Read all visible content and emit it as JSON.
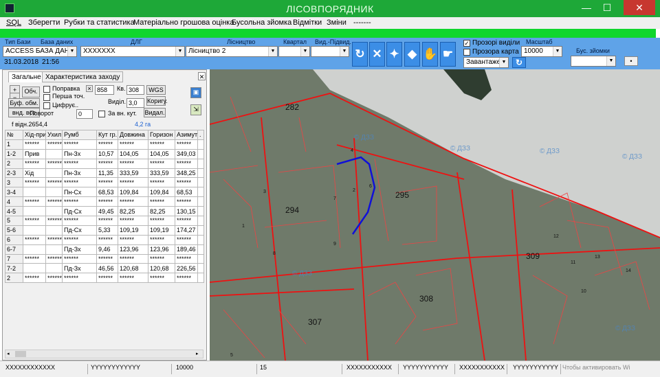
{
  "window": {
    "title": "ЛІСОВПОРЯДНИК",
    "minimize": "—",
    "maximize": "☐",
    "close": "✕"
  },
  "menu": [
    "SQL",
    "Зберегти",
    "Рубки та статистика",
    "Матеріально грошова оцінка",
    "Бусольна зйомка",
    "Відмітки",
    "Зміни",
    "-------"
  ],
  "toolbar": {
    "db_type_label": "Тип Бази",
    "db_label": "База даних",
    "db_value": "ACCESS БАЗА ДАНИ",
    "date": "31.03.2018",
    "time": "21:56",
    "dlg_label": "ДЛГ",
    "dlg_value": "XXXXXXX",
    "forestry_label": "Лісництво",
    "forestry_value": "Лісництво 2",
    "quarter_label": "Квартал",
    "quarter_value": "",
    "subplot_label": "Вид.-Підвид.",
    "subplot_value": "",
    "transparent_plots_label": "Прозорі виділи",
    "transparent_plots_checked": true,
    "transparent_map_label": "Прозора карта",
    "transparent_map_checked": false,
    "load_value": "Завантаже",
    "scale_label": "Масштаб",
    "scale_value": "10000",
    "survey_label": "Бус. зйомки",
    "survey_value": "",
    "small_button": "•"
  },
  "left": {
    "tabs": [
      "Загальне",
      "Характеристика заходу"
    ],
    "close": "✕",
    "plus": "+",
    "minus": "−",
    "calc_button": "Обч.",
    "buffer_button": "Буф. обм.",
    "all_button": "внд. все",
    "correction_label": "Поправка",
    "first_point_label": "Перша точ.",
    "digitize_label": "Цифрує..",
    "rotation_label": "Поворот",
    "rotation_value": "0",
    "small_x": "×",
    "num_value": "858",
    "kv_label": "Кв.",
    "kv_value": "308",
    "wgs_button": "WGS",
    "vydil_label": "Виділ.",
    "vydil_value": "3,0",
    "korig_button": "Коригу.",
    "za_vn_label": "За вн. кут.",
    "vydal_button": "Видал.",
    "deviation": "f відн.2654,4",
    "area": "4,2 га",
    "columns": [
      "№",
      "Хід-при",
      "Ухил",
      "Румб",
      "Кут гр.",
      "Довжина",
      "Горизон",
      "Азимут",
      "."
    ],
    "rows": [
      [
        "1",
        "******",
        "******",
        "******",
        "******",
        "******",
        "******",
        "******"
      ],
      [
        "1-2",
        "Прив",
        "",
        "Пн-Зх",
        "10,57",
        "104,05",
        "104,05",
        "349,03"
      ],
      [
        "2",
        "******",
        "******",
        "******",
        "******",
        "******",
        "******",
        "******"
      ],
      [
        "2-3",
        "Хід",
        "",
        "Пн-Зх",
        "11,35",
        "333,59",
        "333,59",
        "348,25"
      ],
      [
        "3",
        "******",
        "******",
        "******",
        "******",
        "******",
        "******",
        "******"
      ],
      [
        "3-4",
        "",
        "",
        "Пн-Сх",
        "68,53",
        "109,84",
        "109,84",
        "68,53"
      ],
      [
        "4",
        "******",
        "******",
        "******",
        "******",
        "******",
        "******",
        "******"
      ],
      [
        "4-5",
        "",
        "",
        "Пд-Сх",
        "49,45",
        "82,25",
        "82,25",
        "130,15"
      ],
      [
        "5",
        "******",
        "******",
        "******",
        "******",
        "******",
        "******",
        "******"
      ],
      [
        "5-6",
        "",
        "",
        "Пд-Сх",
        "5,33",
        "109,19",
        "109,19",
        "174,27"
      ],
      [
        "6",
        "******",
        "******",
        "******",
        "******",
        "******",
        "******",
        "******"
      ],
      [
        "6-7",
        "",
        "",
        "Пд-Зх",
        "9,46",
        "123,96",
        "123,96",
        "189,46"
      ],
      [
        "7",
        "******",
        "******",
        "******",
        "******",
        "******",
        "******",
        "******"
      ],
      [
        "7-2",
        "",
        "",
        "Пд-Зх",
        "46,56",
        "120,68",
        "120,68",
        "226,56"
      ],
      [
        "2",
        "******",
        "******",
        "******",
        "******",
        "******",
        "******",
        "******"
      ]
    ]
  },
  "map": {
    "quarters": [
      "282",
      "294",
      "295",
      "307",
      "308",
      "309"
    ],
    "plot_numbers": [
      "1",
      "2",
      "3",
      "4",
      "5",
      "6",
      "7",
      "8",
      "9",
      "10",
      "11",
      "12",
      "13",
      "14"
    ],
    "watermarks": [
      "© ДЗЗ",
      "© ДЗЗ",
      "© ДЗЗ",
      "© ДЗЗ",
      "© ДЗЗ",
      "© ДЗЗ"
    ]
  },
  "status": {
    "cells": [
      "XXXXXXXXXXXX",
      "YYYYYYYYYYYY",
      "10000",
      "15",
      "XXXXXXXXXXX",
      "YYYYYYYYYYY",
      "XXXXXXXXXXX",
      "YYYYYYYYYYY"
    ],
    "activate": "Чтобы активировать Wi"
  }
}
